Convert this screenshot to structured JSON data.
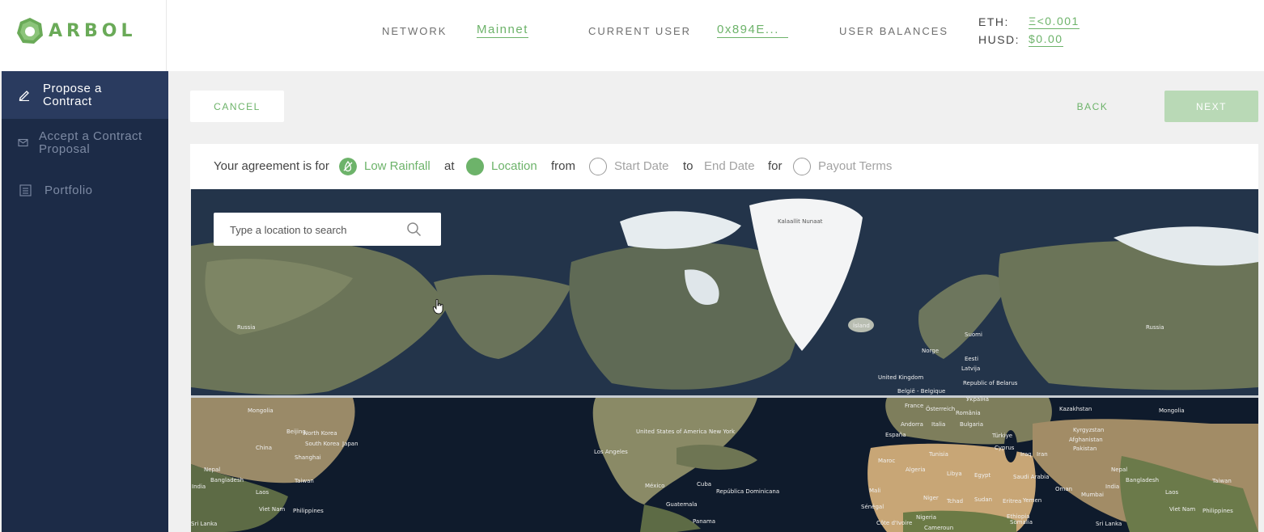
{
  "brand": {
    "name": "ARBOL",
    "color": "#6aaa58"
  },
  "header": {
    "network_label": "NETWORK",
    "network_value": "Mainnet",
    "user_label": "CURRENT USER",
    "user_value": "0x894E...",
    "balances_label": "USER BALANCES",
    "eth_label": "ETH:",
    "eth_value": "Ξ<0.001",
    "husd_label": "HUSD:",
    "husd_value": "$0.00"
  },
  "sidebar": {
    "items": [
      {
        "label_line1": "Propose a",
        "label_line2": "Contract",
        "icon": "pencil-icon",
        "active": true
      },
      {
        "label_line1": "Accept a Contract",
        "label_line2": "Proposal",
        "icon": "envelope-icon",
        "active": false
      },
      {
        "label_line1": "Portfolio",
        "label_line2": "",
        "icon": "document-list-icon",
        "active": false
      }
    ]
  },
  "actions": {
    "cancel": "CANCEL",
    "back": "BACK",
    "next": "NEXT"
  },
  "agreement": {
    "prefix": "Your agreement is for",
    "peril": "Low Rainfall",
    "at": "at",
    "location": "Location",
    "from": "from",
    "start_date": "Start Date",
    "to": "to",
    "end_date": "End Date",
    "for": "for",
    "payout_terms": "Payout Terms"
  },
  "map": {
    "search_placeholder": "Type a location to search",
    "labels": {
      "greenland": "Kalaallit Nunaat",
      "russia_w": "Russia",
      "russia_e": "Russia",
      "iceland": "Ísland",
      "norge": "Norge",
      "suomi": "Suomi",
      "eesti": "Eesti",
      "latvija": "Latvija",
      "uk": "United Kingdom",
      "belarus": "Republic of Belarus",
      "belgium": "België - Belgique",
      "ukraine": "Україна",
      "kazakhstan": "Kazakhstan",
      "mongolia_w": "Mongolia",
      "mongolia_e": "Mongolia",
      "north_korea_w": "North Korea",
      "south_korea_w": "South Korea",
      "japan": "Japan",
      "china_w": "China",
      "usa": "United States of America",
      "new_york": "New York",
      "los_angeles": "Los Angeles",
      "mexico": "México",
      "cuba": "Cuba",
      "dominicana": "República Dominicana",
      "guatemala": "Guatemala",
      "panama": "Panama",
      "france": "France",
      "espana": "España",
      "italia": "Italia",
      "romania": "România",
      "bulgaria": "Bulgaria",
      "turkiye": "Türkiye",
      "cyprus": "Cyprus",
      "iraq": "Iraq",
      "iran": "Iran",
      "egypt": "Egypt",
      "libya": "Libya",
      "algeria": "Algeria",
      "maroc": "Maroc",
      "tunisia": "Tunisia",
      "saudi": "Saudi Arabia",
      "oman": "Oman",
      "afghanistan": "Afghanistan",
      "pakistan": "Pakistan",
      "india_w": "India",
      "india_e": "India",
      "nepal_w": "Nepal",
      "nepal_e": "Nepal",
      "bangladesh_w": "Bangladesh",
      "bangladesh_e": "Bangladesh",
      "laos_w": "Laos",
      "laos_e": "Laos",
      "vietnam_w": "Viet Nam",
      "vietnam_e": "Viet Nam",
      "philippines_w": "Philippines",
      "philippines_e": "Philippines",
      "taiwan_w": "Taiwan",
      "taiwan_e": "Taiwan",
      "sri_lanka_w": "Sri Lanka",
      "sri_lanka_e": "Sri Lanka",
      "senegal": "Sénégal",
      "mali": "Mali",
      "niger": "Niger",
      "nigeria": "Nigeria",
      "chad": "Tchad",
      "sudan": "Sudan",
      "eritrea": "Eritrea",
      "yemen": "Yemen",
      "ethiopia": "Ethiopia",
      "somalia": "Somalia",
      "cote_divoire": "Côte d'Ivoire",
      "cameroun": "Cameroun",
      "kyrgyzstan": "Kyrgyzstan",
      "mumbai": "Mumbai",
      "andorra": "Andorra",
      "osterreich": "Österreich",
      "shanghai": "Shanghai",
      "beijing": "Beijing"
    }
  },
  "colors": {
    "green": "#6db36a",
    "sidebar": "#1c2b47",
    "sidebar_active": "#2a3b5f",
    "next_disabled": "#b9d9b6"
  }
}
